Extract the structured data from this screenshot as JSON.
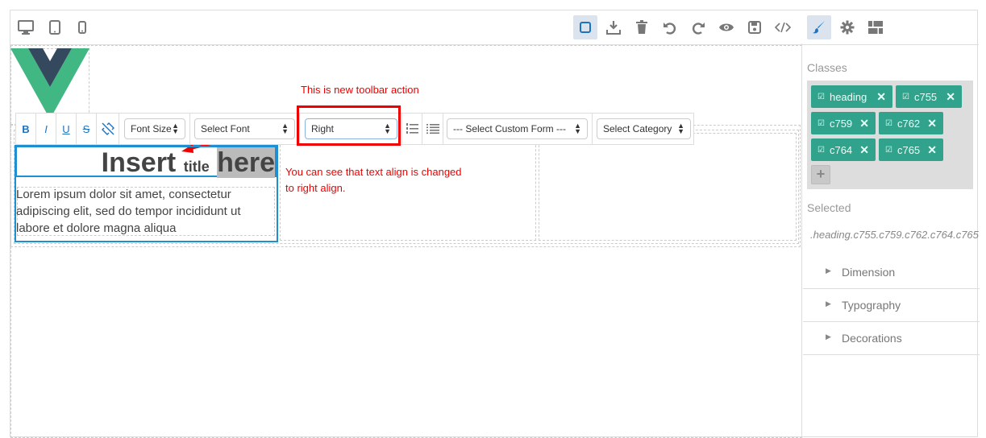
{
  "top_toolbar": {
    "device_icons": [
      "desktop-icon",
      "tablet-icon",
      "mobile-icon"
    ],
    "action_icons": [
      "square-outline-icon",
      "download-icon",
      "trash-icon",
      "undo-icon",
      "redo-icon",
      "eye-icon",
      "save-icon",
      "code-icon"
    ],
    "panel_icons": [
      "paint-brush-icon",
      "gear-icon",
      "grid-icon"
    ],
    "active_color": "#1e73be"
  },
  "rte": {
    "bold": "B",
    "italic": "I",
    "underline": "U",
    "strike": "S",
    "font_size": "Font Size",
    "font": "Select Font",
    "align": "Right",
    "custom_form": "--- Select Custom Form ---",
    "category": "Select Category"
  },
  "annotations": {
    "toolbar_note": "This is new toolbar action",
    "align_note_1": "You can see that text align is changed",
    "align_note_2": "to right align."
  },
  "content": {
    "heading_part1": "Insert",
    "heading_part2": "title",
    "heading_part3": "here",
    "paragraph": "Lorem ipsum dolor sit amet, consectetur adipiscing elit, sed do tempor incididunt ut labore et dolore magna aliqua"
  },
  "style_manager": {
    "classes_title": "Classes",
    "classes": [
      "heading",
      "c755",
      "c759",
      "c762",
      "c764",
      "c765"
    ],
    "tag_color": "#31a38d",
    "selected_title": "Selected",
    "selected_value": ".heading.c755.c759.c762.c764.c765",
    "sectors": [
      "Dimension",
      "Typography",
      "Decorations"
    ]
  }
}
